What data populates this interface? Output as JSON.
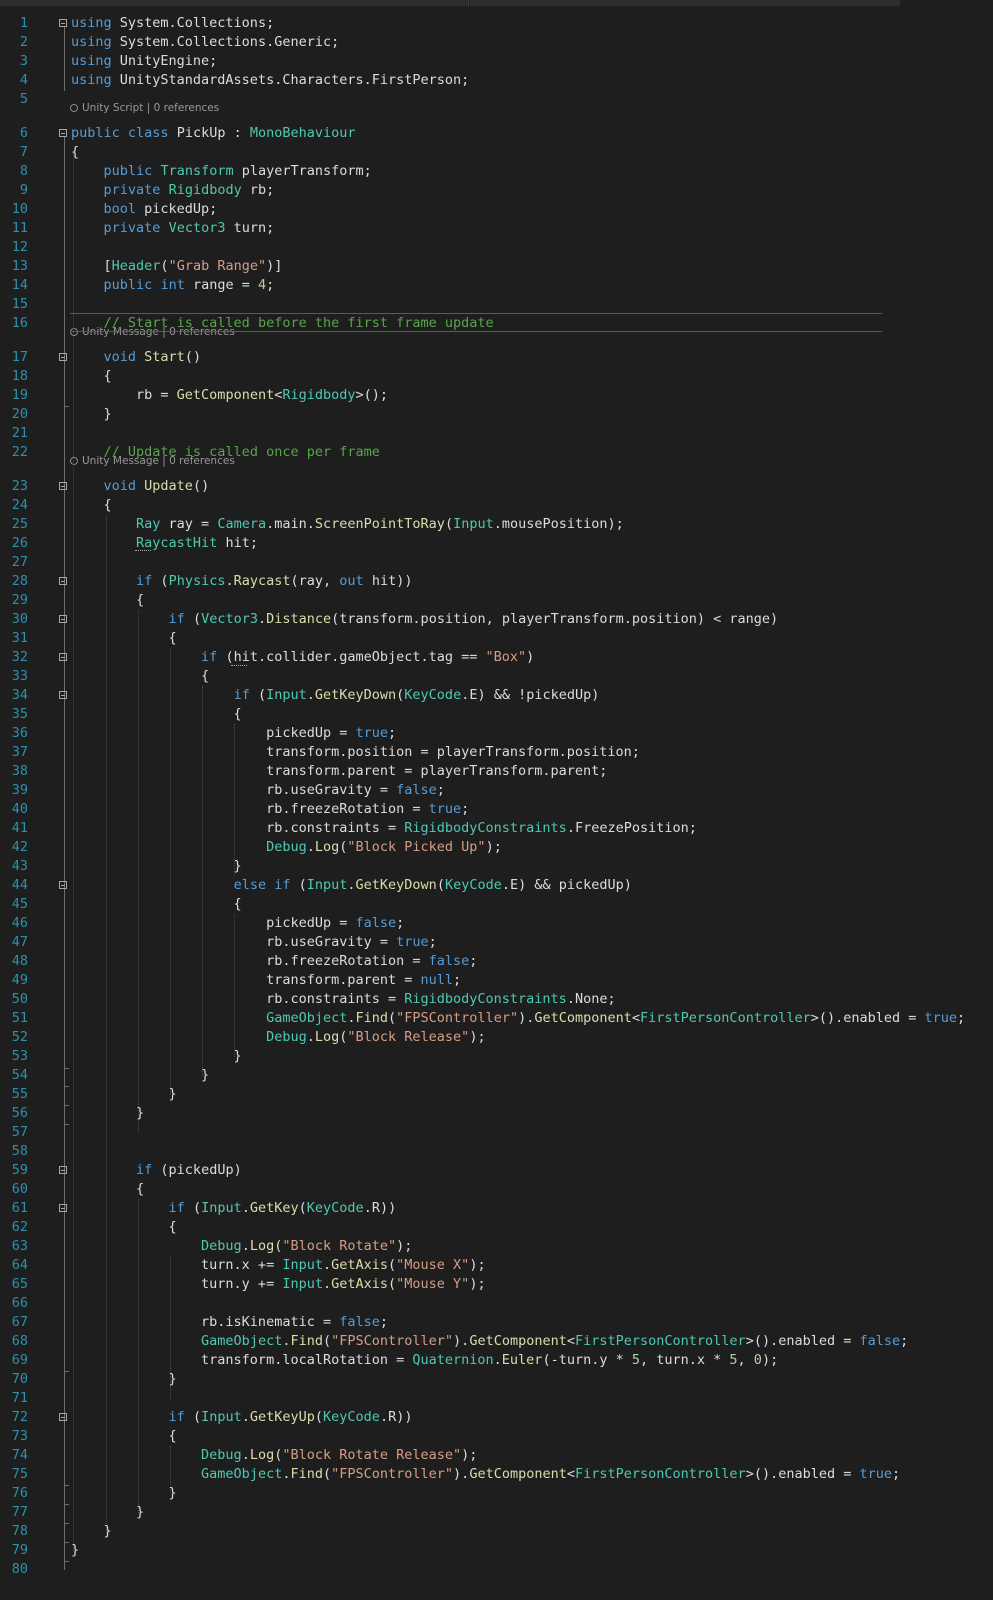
{
  "colors": {
    "background": "#1e1e1e",
    "line_number": "#2b91af",
    "keyword": "#569cd6",
    "type": "#4ec9b0",
    "method": "#dcdcaa",
    "string": "#d69d85",
    "comment": "#57a64a",
    "number": "#b5cea8",
    "text": "#dcdcdc",
    "codelens": "#999999"
  },
  "codelens": {
    "unity_script": "Unity Script | 0 references",
    "unity_message": "Unity Message | 0 references"
  },
  "lines": [
    "using System.Collections;",
    "using System.Collections.Generic;",
    "using UnityEngine;",
    "using UnityStandardAssets.Characters.FirstPerson;",
    "",
    "public class PickUp : MonoBehaviour",
    "{",
    "    public Transform playerTransform;",
    "    private Rigidbody rb;",
    "    bool pickedUp;",
    "    private Vector3 turn;",
    "",
    "    [Header(\"Grab Range\")]",
    "    public int range = 4;",
    "",
    "    // Start is called before the first frame update",
    "    void Start()",
    "    {",
    "        rb = GetComponent<Rigidbody>();",
    "    }",
    "",
    "    // Update is called once per frame",
    "    void Update()",
    "    {",
    "        Ray ray = Camera.main.ScreenPointToRay(Input.mousePosition);",
    "        RaycastHit hit;",
    "",
    "        if (Physics.Raycast(ray, out hit))",
    "        {",
    "            if (Vector3.Distance(transform.position, playerTransform.position) < range)",
    "            {",
    "                if (hit.collider.gameObject.tag == \"Box\")",
    "                {",
    "                    if (Input.GetKeyDown(KeyCode.E) && !pickedUp)",
    "                    {",
    "                        pickedUp = true;",
    "                        transform.position = playerTransform.position;",
    "                        transform.parent = playerTransform.parent;",
    "                        rb.useGravity = false;",
    "                        rb.freezeRotation = true;",
    "                        rb.constraints = RigidbodyConstraints.FreezePosition;",
    "                        Debug.Log(\"Block Picked Up\");",
    "                    }",
    "                    else if (Input.GetKeyDown(KeyCode.E) && pickedUp)",
    "                    {",
    "                        pickedUp = false;",
    "                        rb.useGravity = true;",
    "                        rb.freezeRotation = false;",
    "                        transform.parent = null;",
    "                        rb.constraints = RigidbodyConstraints.None;",
    "                        GameObject.Find(\"FPSController\").GetComponent<FirstPersonController>().enabled = true;",
    "                        Debug.Log(\"Block Release\");",
    "                    }",
    "                }",
    "            }",
    "        }",
    "",
    "",
    "        if (pickedUp)",
    "        {",
    "            if (Input.GetKey(KeyCode.R))",
    "            {",
    "                Debug.Log(\"Block Rotate\");",
    "                turn.x += Input.GetAxis(\"Mouse X\");",
    "                turn.y += Input.GetAxis(\"Mouse Y\");",
    "",
    "                rb.isKinematic = false;",
    "                GameObject.Find(\"FPSController\").GetComponent<FirstPersonController>().enabled = false;",
    "                transform.localRotation = Quaternion.Euler(-turn.y * 5, turn.x * 5, 0);",
    "            }",
    "",
    "            if (Input.GetKeyUp(KeyCode.R))",
    "            {",
    "                Debug.Log(\"Block Rotate Release\");",
    "                GameObject.Find(\"FPSController\").GetComponent<FirstPersonController>().enabled = true;",
    "            }",
    "        }",
    "    }",
    "}",
    ""
  ]
}
